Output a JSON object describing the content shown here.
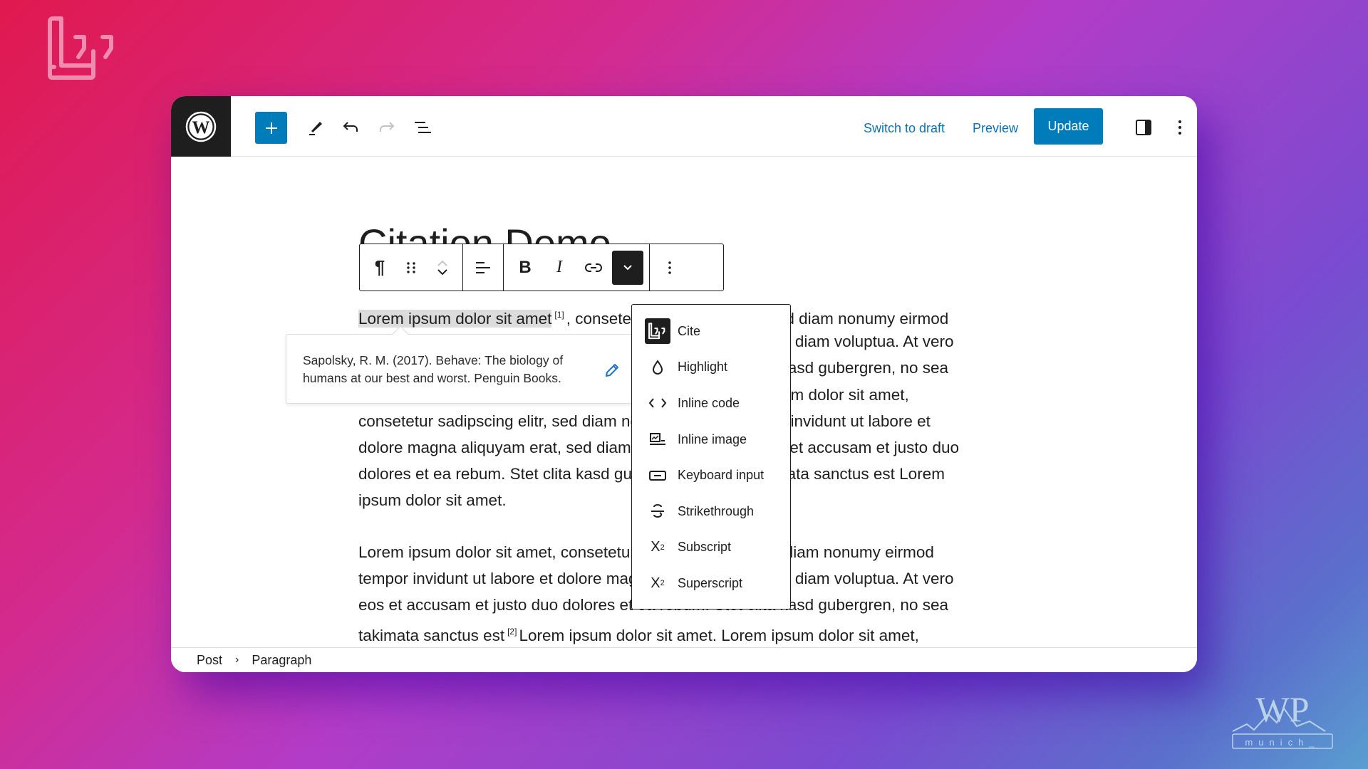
{
  "header": {
    "switch_to_draft": "Switch to draft",
    "preview": "Preview",
    "update": "Update",
    "icons": [
      "wordpress-logo",
      "plus-icon",
      "pencil-icon",
      "undo-icon",
      "redo-icon",
      "list-view-icon",
      "sidebar-toggle-icon",
      "more-vertical-icon"
    ]
  },
  "post": {
    "title": "Citation Demo",
    "paragraph1": {
      "lines": [
        {
          "selected": "Lorem ipsum dolor sit amet",
          "ref": "[1]",
          "rest": ", consetetur sadipscing elitr, sed diam nonumy eirmod"
        },
        {
          "text": "tempor invidunt ut labore et dolore magna aliquyam erat, sed diam voluptua. At vero"
        },
        {
          "text": "eos et accusam et justo duo dolores et ea rebum. Stet clita kasd gubergren, no sea"
        },
        {
          "text": "takimata sanctus est Lorem ipsum dolor sit amet. Lorem ipsum dolor sit amet,"
        },
        {
          "text": "consetetur sadipscing elitr, sed diam nonumy eirmod tempor invidunt ut labore et"
        },
        {
          "text": "dolore magna aliquyam erat, sed diam voluptua. At vero eos et accusam et justo duo"
        },
        {
          "text": "dolores et ea rebum. Stet clita kasd gubergren, no sea takimata sanctus est Lorem"
        },
        {
          "text": "ipsum dolor sit amet."
        }
      ]
    },
    "paragraph2": {
      "lines": [
        {
          "text": "Lorem ipsum dolor sit amet, consetetur sadipscing elitr, sed diam nonumy eirmod"
        },
        {
          "text": "tempor invidunt ut labore et dolore magna aliquyam erat, sed diam voluptua. At vero"
        },
        {
          "text": "eos et accusam et justo duo dolores et ea rebum. Stet clita kasd gubergren, no sea"
        },
        {
          "before": "takimata sanctus est",
          "ref": "[2]",
          "after": "Lorem ipsum dolor sit amet. Lorem ipsum dolor sit amet,"
        }
      ]
    }
  },
  "block_toolbar": {
    "buttons": [
      "paragraph",
      "drag",
      "move-up",
      "move-down",
      "align",
      "bold",
      "italic",
      "link",
      "more-formats",
      "options"
    ]
  },
  "citation_popover": {
    "text": "Sapolsky, R. M. (2017). Behave: The biology of humans at our best and worst. Penguin Books."
  },
  "format_menu": {
    "items": [
      {
        "label": "Cite",
        "icon": "cite-icon",
        "active": true
      },
      {
        "label": "Highlight",
        "icon": "droplet-icon"
      },
      {
        "label": "Inline code",
        "icon": "code-icon"
      },
      {
        "label": "Inline image",
        "icon": "image-icon"
      },
      {
        "label": "Keyboard input",
        "icon": "keyboard-icon"
      },
      {
        "label": "Strikethrough",
        "icon": "strikethrough-icon"
      },
      {
        "label": "Subscript",
        "icon": "subscript-icon"
      },
      {
        "label": "Superscript",
        "icon": "superscript-icon"
      }
    ]
  },
  "breadcrumb": {
    "items": [
      "Post",
      "Paragraph"
    ],
    "separator": "›"
  },
  "colors": {
    "accent": "#007cba",
    "link": "#0a72b1",
    "dark": "#1e1e1e"
  },
  "watermark": {
    "text": "WP",
    "subtext": "munich_"
  }
}
